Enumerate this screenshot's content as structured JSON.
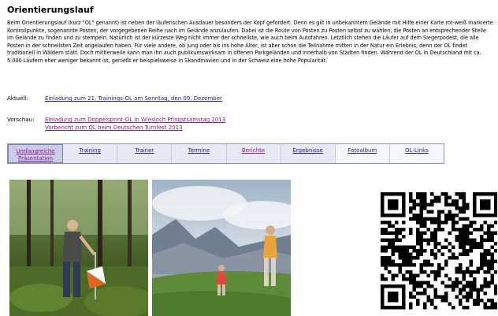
{
  "page": {
    "title": "Orientierungslauf",
    "intro_lines": [
      "Beim Orientierungslauf (kurz \"OL\" genannt) ist neben der läuferischen Ausdauer besonders der Kopf gefordert. Denn es gilt in unbekanntem Gelände mit Hilfe einer Karte rot-weiß markierte",
      "Kontrollpunkte, sogenannte Posten, der vorgegebenen Reihe nach im Gelände anzulaufen. Dabei ist die Route von Posten zu Posten selbst zu wählen, die Posten an entsprechender Stelle",
      "im Gelände zu finden und zu stempeln. Natürlich ist der kürzeste Weg nicht immer der schnellste, wie auch beim Autofahren. Letztlich stehen die Läufer auf dem Siegerpodest, die alle",
      "Posten in der schnellsten Zeit angelaufen haben. Für viele andere, ob jung oder bis ins hohe Alter, ist aber schon die Teilnahme mitten in der Natur ein Erlebnis, denn der OL findet",
      "traditionell in Wäldern statt. Doch mittlerweile kann man ihn auch publikumswirksam in offenen Parkgeländen und innerhalb von Städten finden. Während der OL in Deutschland mit ca.",
      "5.000 Läufern eher weniger bekannt ist, genießt er beispielsweise in Skandinavien und in der Schweiz eine hohe Popularität."
    ]
  },
  "aktuell": {
    "label": "Aktuell:",
    "link": "Einladung zum 21. Trainings-OL am Sonntag, den 09. Dezember"
  },
  "vorschau": {
    "label": "Vorschau:",
    "link1": "Einladung zum Doppelsprint-OL in Wiesloch Pfingstsamstag 2013",
    "link2": "Vorbericht zum OL beim Deutschen Turnfest 2013"
  },
  "nav": {
    "items": [
      {
        "label1": "Umfangreiche",
        "label2": "Präsentation"
      },
      {
        "label1": "Training",
        "label2": ""
      },
      {
        "label1": "Trainer",
        "label2": ""
      },
      {
        "label1": "Termine",
        "label2": ""
      },
      {
        "label1": "Berichte",
        "label2": ""
      },
      {
        "label1": "Ergebnisse",
        "label2": ""
      },
      {
        "label1": "Fotoalbum",
        "label2": ""
      },
      {
        "label1": "OL-Links",
        "label2": ""
      }
    ]
  },
  "colors": {
    "link": "#1a1aa6",
    "visited": "#8a1a8a",
    "nav_bg": "#e7e9f5"
  },
  "icons": {
    "qr": "qr-code-icon"
  }
}
